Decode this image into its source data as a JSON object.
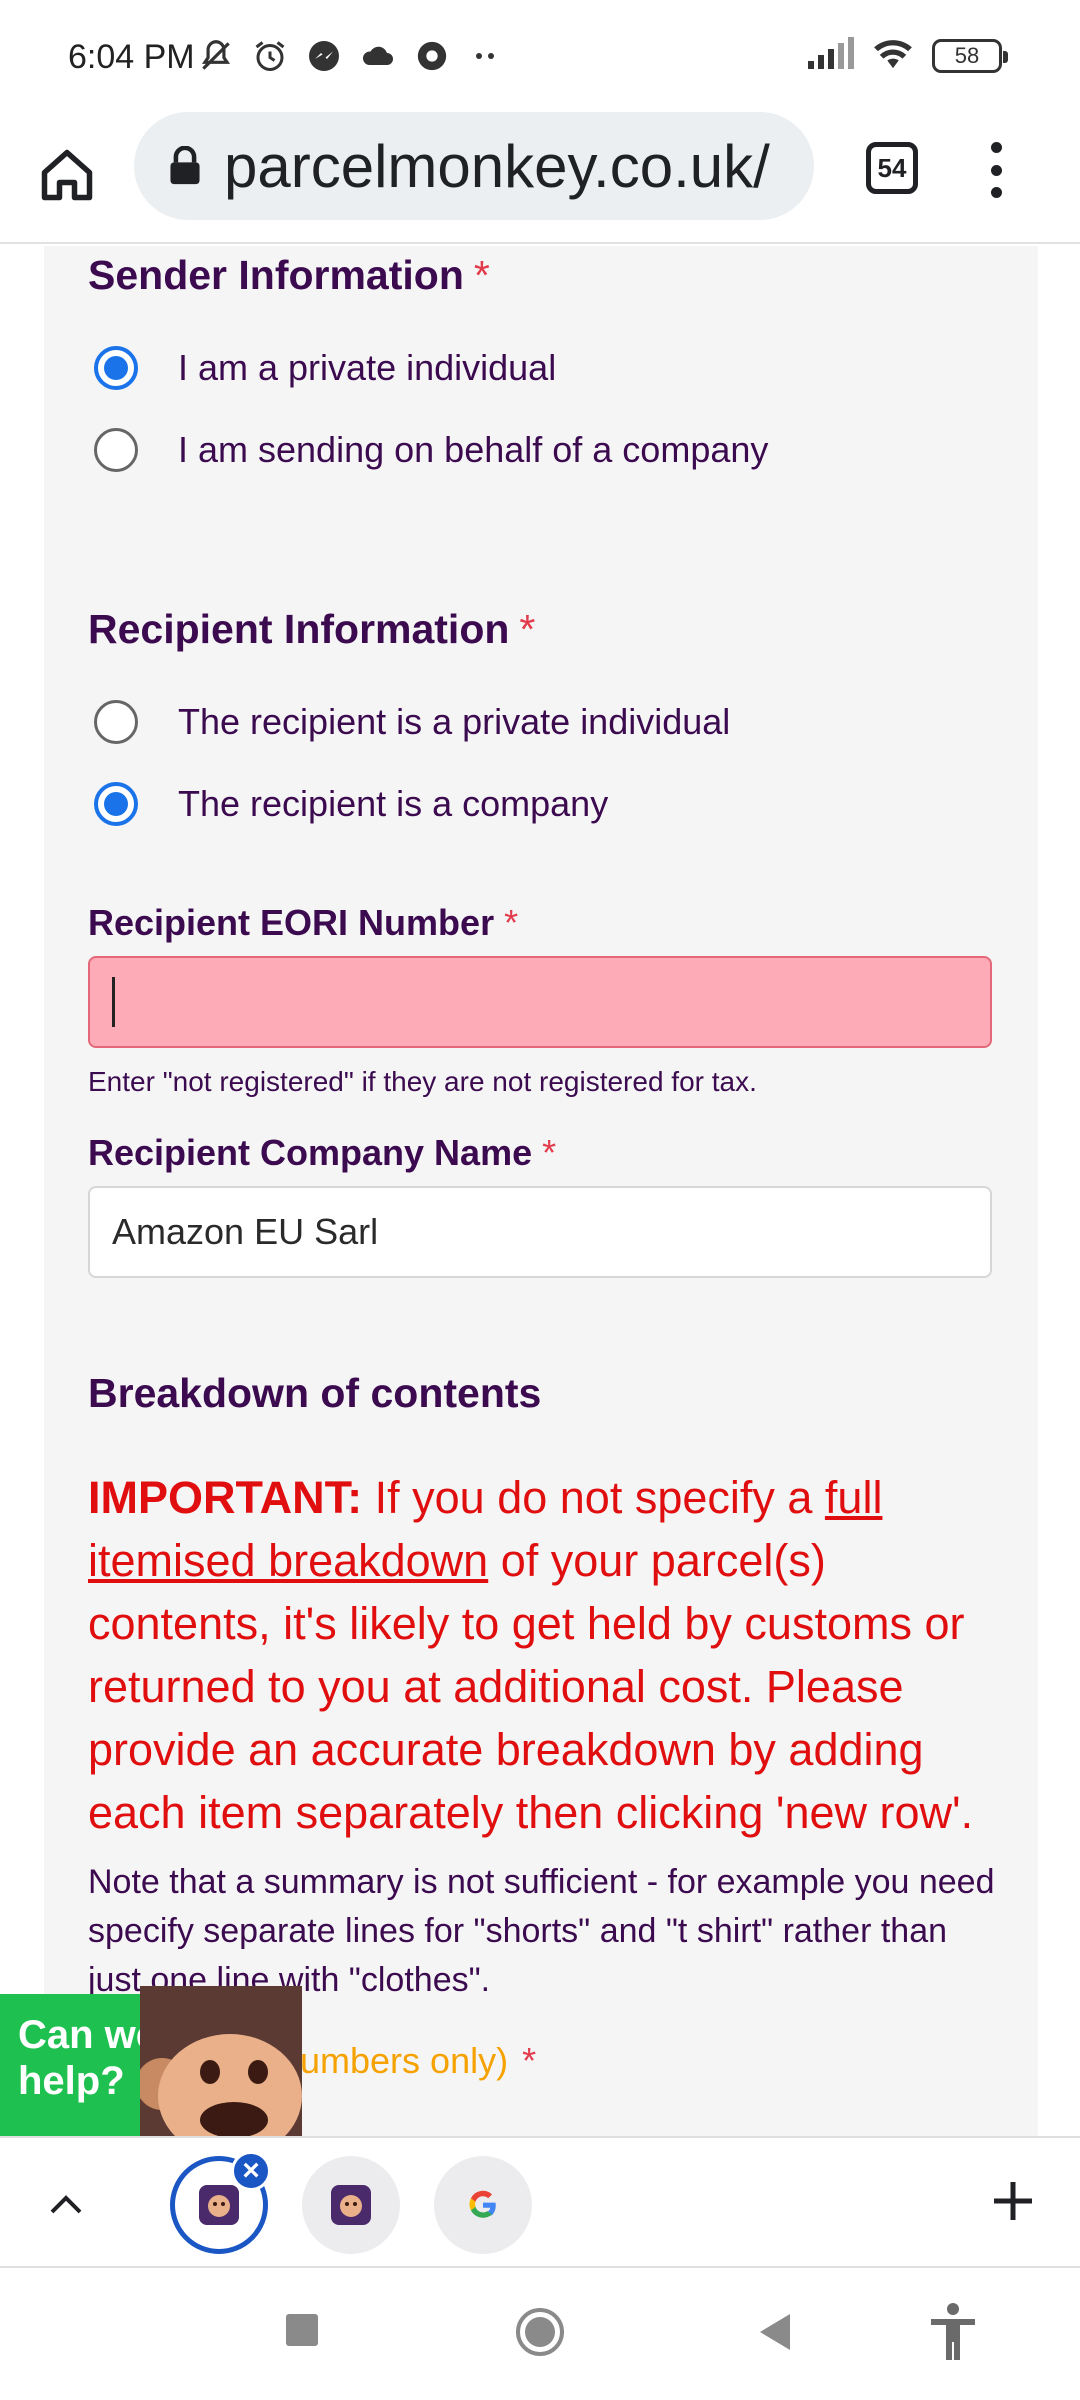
{
  "status_bar": {
    "time": "6:04 PM",
    "battery": "58",
    "left_icons": [
      "mute-icon",
      "alarm-icon",
      "messenger-icon",
      "cloud-icon",
      "chrome-icon",
      "more-dots-icon"
    ],
    "right_icons": [
      "signal-icon",
      "wifi-icon",
      "battery-icon"
    ]
  },
  "browser": {
    "url": "parcelmonkey.co.uk/",
    "tab_count": "54"
  },
  "form": {
    "sender": {
      "title": "Sender Information",
      "required_mark": "*",
      "options": [
        {
          "label": "I am a private individual",
          "checked": true
        },
        {
          "label": "I am sending on behalf of a company",
          "checked": false
        }
      ]
    },
    "recipient": {
      "title": "Recipient Information",
      "required_mark": "*",
      "options": [
        {
          "label": "The recipient is a private individual",
          "checked": false
        },
        {
          "label": "The recipient is a company",
          "checked": true
        }
      ]
    },
    "eori": {
      "label": "Recipient EORI Number",
      "required_mark": "*",
      "value": "",
      "hint": "Enter \"not registered\" if they are not registered for tax."
    },
    "company": {
      "label": "Recipient Company Name",
      "required_mark": "*",
      "value": "Amazon EU Sarl"
    },
    "breakdown": {
      "title": "Breakdown of contents",
      "important_label": "IMPORTANT:",
      "important_text_1": " If you do not specify a ",
      "important_link": "full itemised breakdown",
      "important_text_2": " of your parcel(s) contents, it's likely to get held by customs or returned to you at additional cost. Please provide an accurate breakdown by adding each item separately then clicking 'new row'.",
      "note": "Note that a summary is not sufficient - for example you need specify separate lines for \"shorts\" and \"t shirt\" rather than just one line with \"clothes\".",
      "partial_label": "umbers only)",
      "partial_required": "*"
    }
  },
  "help_widget": {
    "text_line1": "Can we",
    "text_line2": "help?"
  },
  "tab_strip": {
    "tabs": [
      {
        "name": "parcelmonkey-tab-active",
        "active": true
      },
      {
        "name": "parcelmonkey-tab",
        "active": false
      },
      {
        "name": "google-tab",
        "active": false
      }
    ]
  },
  "colors": {
    "heading": "#3b0a4f",
    "required": "#e23b4b",
    "important": "#e00e0e",
    "radio_checked": "#1a73e8",
    "input_error_bg": "#fdacb7",
    "help_green": "#1ec050"
  }
}
